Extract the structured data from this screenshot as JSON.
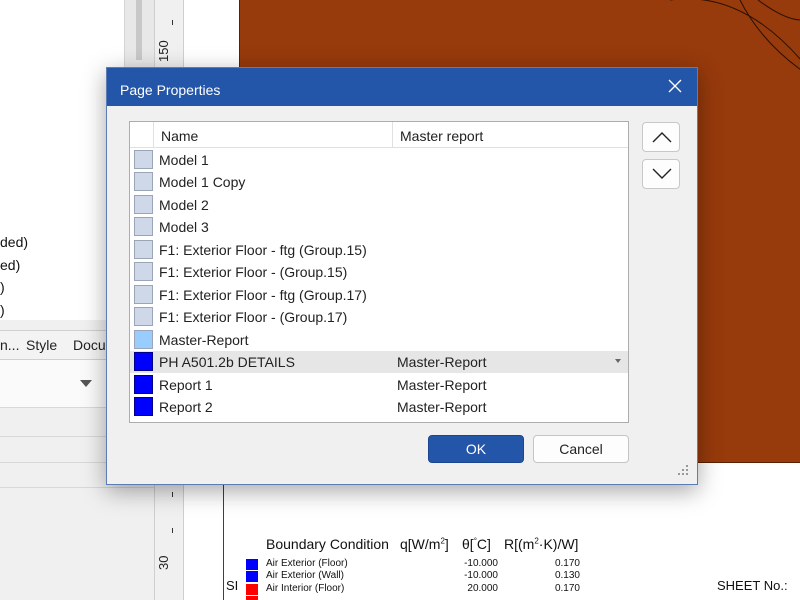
{
  "dialog": {
    "title": "Page Properties",
    "columns": [
      "Name",
      "Master report"
    ],
    "rows": [
      {
        "name": "Model 1",
        "master": "",
        "color": "#ced8e8"
      },
      {
        "name": "Model 1 Copy",
        "master": "",
        "color": "#ced8e8"
      },
      {
        "name": "Model 2",
        "master": "",
        "color": "#ced8e8"
      },
      {
        "name": "Model 3",
        "master": "",
        "color": "#ced8e8"
      },
      {
        "name": "F1: Exterior Floor - ftg (Group.15)",
        "master": "",
        "color": "#ced8e8"
      },
      {
        "name": "F1: Exterior Floor - (Group.15)",
        "master": "",
        "color": "#ced8e8"
      },
      {
        "name": "F1: Exterior Floor - ftg (Group.17)",
        "master": "",
        "color": "#ced8e8"
      },
      {
        "name": "F1: Exterior Floor - (Group.17)",
        "master": "",
        "color": "#ced8e8"
      },
      {
        "name": "Master-Report",
        "master": "",
        "color": "#99ccff"
      },
      {
        "name": "PH A501.2b DETAILS",
        "master": "Master-Report",
        "color": "#0000ff",
        "selected": true
      },
      {
        "name": "Report 1",
        "master": "Master-Report",
        "color": "#0000ff"
      },
      {
        "name": "Report 2",
        "master": "Master-Report",
        "color": "#0000ff"
      }
    ],
    "ok_label": "OK",
    "cancel_label": "Cancel",
    "accent_color": "#2356a8"
  },
  "background": {
    "tree_items": [
      "ded)",
      "ed)",
      ")",
      ")"
    ],
    "tabs": [
      "n...",
      "Style",
      "Docu"
    ],
    "ruler_labels": [
      "150",
      "30"
    ],
    "boundary": {
      "headers": [
        "Boundary Condition",
        "q[W/m",
        "θ[",
        "R[(m"
      ],
      "headers_sup": [
        "2",
        "°",
        "2"
      ],
      "headers_after": [
        "]",
        "C]",
        "·K)/W]"
      ],
      "rows": [
        {
          "label": "Air Exterior (Floor)",
          "theta": "-10.000",
          "r": "0.170",
          "color": "#0000ff"
        },
        {
          "label": "Air Exterior (Wall)",
          "theta": "-10.000",
          "r": "0.130",
          "color": "#0000ff"
        },
        {
          "label": "Air Interior (Floor)",
          "theta": "20.000",
          "r": "0.170",
          "color": "#ff0000"
        }
      ]
    },
    "sheet_left": "SI",
    "sheet_label": "SHEET No.:",
    "model_fill_color": "#973a0c"
  }
}
